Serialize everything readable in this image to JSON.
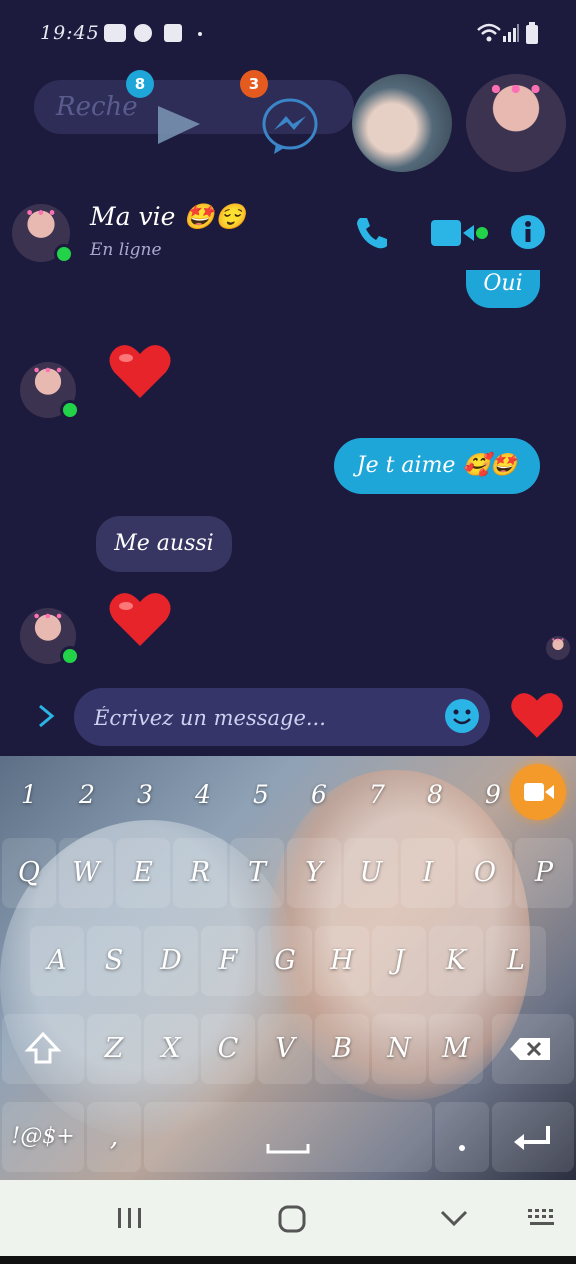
{
  "status_bar": {
    "time": "19:45"
  },
  "chat_heads": {
    "search_placeholder": "Reche",
    "play_badge": "8",
    "messenger_badge": "3"
  },
  "header": {
    "contact_name": "Ma vie",
    "contact_name_emoji": "🤩😌",
    "contact_status": "En ligne"
  },
  "messages": {
    "out_top_partial": "Oui",
    "out_love": "Je t aime 🥰🤩",
    "in_me_too": "Me aussi"
  },
  "composer": {
    "placeholder": "Écrivez un message..."
  },
  "keyboard": {
    "numbers": [
      "1",
      "2",
      "3",
      "4",
      "5",
      "6",
      "7",
      "8",
      "9"
    ],
    "row1": [
      "Q",
      "W",
      "E",
      "R",
      "T",
      "Y",
      "U",
      "I",
      "O",
      "P"
    ],
    "row2": [
      "A",
      "S",
      "D",
      "F",
      "G",
      "H",
      "J",
      "K",
      "L"
    ],
    "row3": [
      "Z",
      "X",
      "C",
      "V",
      "B",
      "N",
      "M"
    ],
    "symbols_label": "!@$+",
    "comma_label": ","
  },
  "colors": {
    "background": "#1d1b3d",
    "outgoing_bubble": "#1fa6d9",
    "incoming_bubble": "#373663",
    "accent": "#2ab5e6",
    "online": "#22d34a",
    "heart": "#e8242b"
  }
}
